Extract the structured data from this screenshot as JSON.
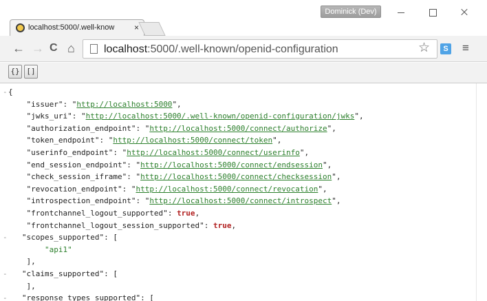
{
  "window": {
    "profile_name": "Dominick (Dev)",
    "min_icon": "minimize-icon",
    "max_icon": "maximize-icon",
    "close_icon": "close-icon"
  },
  "tab": {
    "title": "localhost:5000/.well-know",
    "close_glyph": "×"
  },
  "toolbar": {
    "back_glyph": "←",
    "forward_glyph": "→",
    "reload_glyph": "C",
    "home_glyph": "⌂",
    "url_host": "localhost",
    "url_rest": ":5000/.well-known/openid-configuration",
    "star_glyph": "☆",
    "extension_label": "S",
    "menu_glyph": "≡"
  },
  "viewer": {
    "object_toggle": "{}",
    "array_toggle": "[]"
  },
  "json": {
    "open_brace": "{",
    "collapse_glyph": "-",
    "entries": [
      {
        "key": "\"issuer\"",
        "value": "http://localhost:5000"
      },
      {
        "key": "\"jwks_uri\"",
        "value": "http://localhost:5000/.well-known/openid-configuration/jwks"
      },
      {
        "key": "\"authorization_endpoint\"",
        "value": "http://localhost:5000/connect/authorize"
      },
      {
        "key": "\"token_endpoint\"",
        "value": "http://localhost:5000/connect/token"
      },
      {
        "key": "\"userinfo_endpoint\"",
        "value": "http://localhost:5000/connect/userinfo"
      },
      {
        "key": "\"end_session_endpoint\"",
        "value": "http://localhost:5000/connect/endsession"
      },
      {
        "key": "\"check_session_iframe\"",
        "value": "http://localhost:5000/connect/checksession"
      },
      {
        "key": "\"revocation_endpoint\"",
        "value": "http://localhost:5000/connect/revocation"
      },
      {
        "key": "\"introspection_endpoint\"",
        "value": "http://localhost:5000/connect/introspect"
      }
    ],
    "bools": [
      {
        "key": "\"frontchannel_logout_supported\"",
        "value": "true"
      },
      {
        "key": "\"frontchannel_logout_session_supported\"",
        "value": "true"
      }
    ],
    "scopes_key": "\"scopes_supported\"",
    "scopes_item": "\"api1\"",
    "claims_key": "\"claims_supported\"",
    "response_types_key": "\"response_types_supported\"",
    "array_open": "[",
    "array_close": "],"
  }
}
